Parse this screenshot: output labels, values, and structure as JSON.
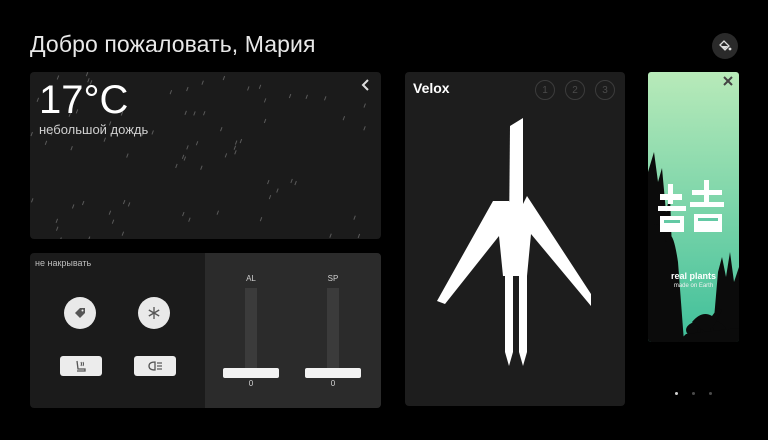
{
  "greeting": "Добро пожаловать, Мария",
  "icons": {
    "theme": "paint-bucket-icon",
    "weather_expand": "chevron-left-icon",
    "ad_close": "close-icon",
    "button_1": "tag-icon",
    "button_2": "snowflake-icon",
    "button_3": "seat-heat-icon",
    "button_4": "headlight-icon"
  },
  "weather": {
    "temperature": "17°C",
    "condition": "небольшой дождь"
  },
  "controls": {
    "label": "не накрывать",
    "sliders": [
      {
        "label": "AL",
        "value": "0"
      },
      {
        "label": "SP",
        "value": "0"
      }
    ]
  },
  "velox": {
    "title": "Velox",
    "steps": [
      "1",
      "2",
      "3"
    ]
  },
  "ad": {
    "title": "real plants",
    "subtitle": "made on Earth",
    "bg_top": "#a9e6b0",
    "bg_bottom": "#4fc3a0"
  },
  "pager": {
    "count": 3,
    "active": 1
  },
  "colors": {
    "background": "#000000",
    "panel": "#1b1b1b",
    "panel_light": "#2b2b2b"
  }
}
